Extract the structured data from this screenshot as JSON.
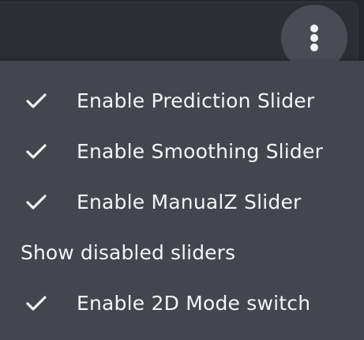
{
  "menu_button": {
    "icon": "more-vertical-icon"
  },
  "menu": {
    "items": [
      {
        "label": "Enable Prediction Slider",
        "checked": true,
        "icon": "check-icon"
      },
      {
        "label": "Enable Smoothing Slider",
        "checked": true,
        "icon": "check-icon"
      },
      {
        "label": "Enable ManualZ Slider",
        "checked": true,
        "icon": "check-icon"
      },
      {
        "label": "Enable 2D Mode switch",
        "checked": true,
        "icon": "check-icon"
      }
    ],
    "section_label": "Show disabled sliders"
  },
  "colors": {
    "background": "#2a2c31",
    "menu_background": "#44464d",
    "button_background": "#494c53",
    "text": "#f4f5f7"
  }
}
